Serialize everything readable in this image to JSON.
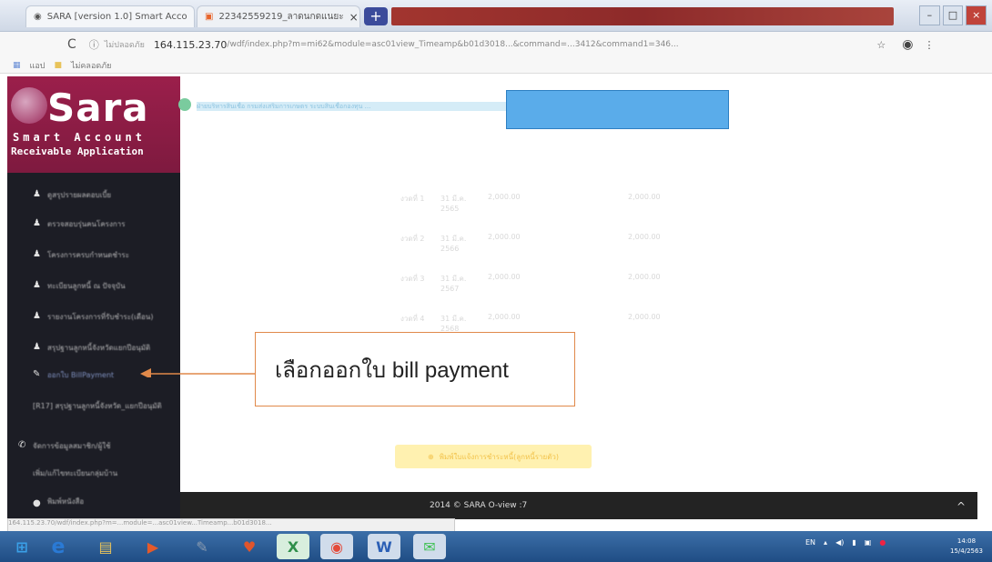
{
  "browser": {
    "tabs": [
      {
        "label": "SARA [version 1.0] Smart Acco",
        "close": "×"
      },
      {
        "label": "22342559219_ลาดนกดแนยะ",
        "close": "×"
      }
    ],
    "new_tab": "+",
    "window_controls": {
      "minimize": "–",
      "maximize": "□",
      "close": "×"
    },
    "back_icon": "C",
    "url": "164.115.23.70",
    "url_path": "/wdf/index.php?m=mi62&module=asc01view_Timeamp&b01d3018...&command=...3412&command1=346...",
    "security_label": "ไม่ปลอดภัย",
    "bookmarks": [
      "แอป",
      "ไม่คลอดภัย"
    ]
  },
  "app": {
    "logo_text": "Sara",
    "subtitle1": "Smart Account",
    "subtitle2": "Receivable Application",
    "menu": [
      {
        "label": "ดูสรุปรายผลตอบเบี้ย",
        "active": false
      },
      {
        "label": "ตรวจสอบรุ่นคนโครงการ",
        "active": false
      },
      {
        "label": "โครงการครบกำหนดชำระ",
        "active": false
      },
      {
        "label": "ทะเบียนลูกหนี้ ณ ปัจจุบัน",
        "active": false
      },
      {
        "label": "รายงานโครงการที่รับชำระ(เดือน)",
        "active": false
      },
      {
        "label": "สรุปฐานลูกหนี้จังหวัดแยกปีอนุมัติ",
        "active": false
      },
      {
        "label": "ออกใบ BillPayment",
        "active": true
      },
      {
        "label": "[R17] สรุปฐานลูกหนี้จังหวัด_แยกปีอนุมัติ",
        "active": false
      },
      {
        "label": "จัดการข้อมูลสมาชิก/ผู้ใช้",
        "active": false
      },
      {
        "label": "เพิ่ม/แก้ไขทะเบียนกลุ่มบ้าน",
        "active": false
      },
      {
        "label": "พิมพ์หนังสือ",
        "active": false
      }
    ],
    "header_strip": "ฝ่ายบริหารสินเชื่อ กรมส่งเสริมการเกษตร ระบบสินเชื่อกองทุน ...",
    "callout_text": "เลือกออกใบ bill payment",
    "action_button": "พิมพ์ใบแจ้งการชำระหนี้(ลูกหนี้รายตัว)",
    "footer": "2014 © SARA O-view :7",
    "back_to_top": "^",
    "status_url": "164.115.23.70/wdf/index.php?m=...module=...asc01view...Timeamp...b01d3018...",
    "faint_rows": [
      {
        "col1": "งวดที่ 1",
        "col2": "31 มี.ค. 2565",
        "col3": "2,000.00",
        "col4": "",
        "col5": "2,000.00"
      },
      {
        "col1": "งวดที่ 2",
        "col2": "31 มี.ค. 2566",
        "col3": "2,000.00",
        "col4": "",
        "col5": "2,000.00"
      },
      {
        "col1": "งวดที่ 3",
        "col2": "31 มี.ค. 2567",
        "col3": "2,000.00",
        "col4": "",
        "col5": "2,000.00"
      },
      {
        "col1": "งวดที่ 4",
        "col2": "31 มี.ค. 2568",
        "col3": "2,000.00",
        "col4": "",
        "col5": "2,000.00"
      }
    ]
  },
  "taskbar": {
    "apps": [
      {
        "name": "windows-start",
        "glyph": "⊞",
        "color": "#3aa0e8"
      },
      {
        "name": "internet-explorer",
        "glyph": "e",
        "color": "#2a7ad5"
      },
      {
        "name": "file-explorer",
        "glyph": "▤",
        "color": "#e8c35a"
      },
      {
        "name": "media-player",
        "glyph": "▶",
        "color": "#e55a2a"
      },
      {
        "name": "app-tools",
        "glyph": "✎",
        "color": "#8a9bb0"
      },
      {
        "name": "brave",
        "glyph": "♥",
        "color": "#e0552d"
      },
      {
        "name": "excel",
        "glyph": "X",
        "color": "#2f8f4a"
      },
      {
        "name": "chrome",
        "glyph": "◉",
        "color": "#e44a3a"
      },
      {
        "name": "word",
        "glyph": "W",
        "color": "#2b5fb5"
      },
      {
        "name": "line",
        "glyph": "✉",
        "color": "#3cc050"
      }
    ],
    "lang": "EN",
    "time": "14:08",
    "date": "15/4/2563"
  }
}
